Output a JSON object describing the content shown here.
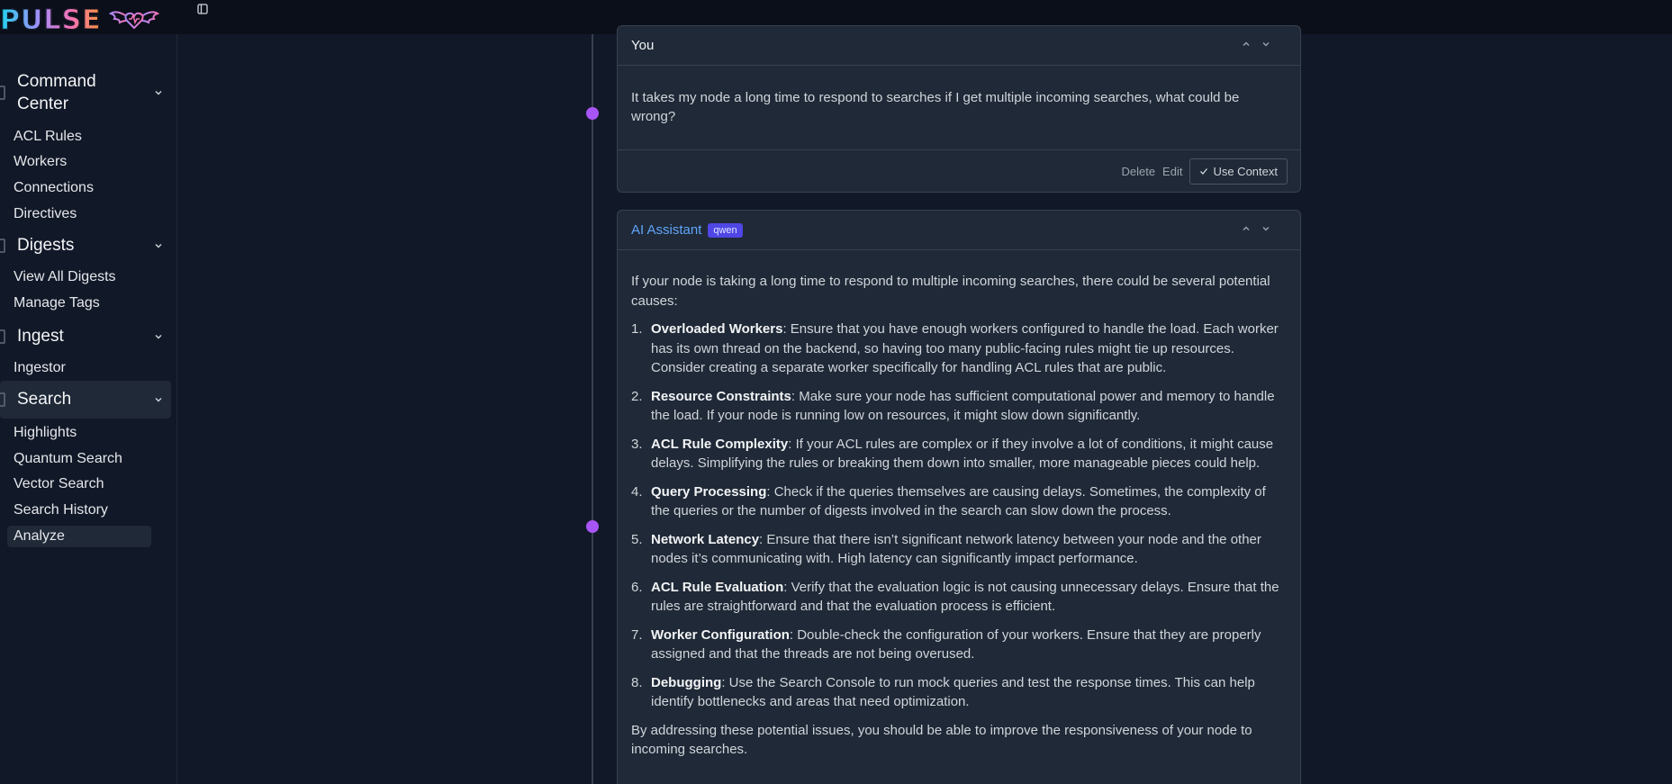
{
  "app": {
    "logo_text": "PULSE"
  },
  "sidebar": {
    "sections": [
      {
        "label": "Command Center",
        "items": [
          "ACL Rules",
          "Workers",
          "Connections",
          "Directives"
        ]
      },
      {
        "label": "Digests",
        "items": [
          "View All Digests",
          "Manage Tags"
        ]
      },
      {
        "label": "Ingest",
        "items": [
          "Ingestor"
        ]
      },
      {
        "label": "Search",
        "items": [
          "Highlights",
          "Quantum Search",
          "Vector Search",
          "Search History",
          "Analyze"
        ]
      }
    ],
    "active_item": "Analyze"
  },
  "chat": {
    "user_message": {
      "author": "You",
      "text": "It takes my node a long time to respond to searches if I get multiple incoming searches, what could be wrong?",
      "actions": {
        "delete": "Delete",
        "edit": "Edit",
        "use_context": "Use Context"
      }
    },
    "ai_message": {
      "author": "AI Assistant",
      "model_badge": "qwen",
      "intro": "If your node is taking a long time to respond to multiple incoming searches, there could be several potential causes:",
      "items": [
        {
          "num": "1.",
          "title": "Overloaded Workers",
          "text": ": Ensure that you have enough workers configured to handle the load. Each worker has its own thread on the backend, so having too many public-facing rules might tie up resources. Consider creating a separate worker specifically for handling ACL rules that are public."
        },
        {
          "num": "2.",
          "title": "Resource Constraints",
          "text": ": Make sure your node has sufficient computational power and memory to handle the load. If your node is running low on resources, it might slow down significantly."
        },
        {
          "num": "3.",
          "title": "ACL Rule Complexity",
          "text": ": If your ACL rules are complex or if they involve a lot of conditions, it might cause delays. Simplifying the rules or breaking them down into smaller, more manageable pieces could help."
        },
        {
          "num": "4.",
          "title": "Query Processing",
          "text": ": Check if the queries themselves are causing delays. Sometimes, the complexity of the queries or the number of digests involved in the search can slow down the process."
        },
        {
          "num": "5.",
          "title": "Network Latency",
          "text": ": Ensure that there isn’t significant network latency between your node and the other nodes it’s communicating with. High latency can significantly impact performance."
        },
        {
          "num": "6.",
          "title": "ACL Rule Evaluation",
          "text": ": Verify that the evaluation logic is not causing unnecessary delays. Ensure that the rules are straightforward and that the evaluation process is efficient."
        },
        {
          "num": "7.",
          "title": "Worker Configuration",
          "text": ": Double-check the configuration of your workers. Ensure that they are properly assigned and that the threads are not being overused."
        },
        {
          "num": "8.",
          "title": "Debugging",
          "text": ": Use the Search Console to run mock queries and test the response times. This can help identify bottlenecks and areas that need optimization."
        }
      ],
      "outro": "By addressing these potential issues, you should be able to improve the responsiveness of your node to incoming searches."
    }
  },
  "colors": {
    "accent": "#a855f7",
    "ai_title": "#60a5fa",
    "badge": "#4f46e5"
  }
}
